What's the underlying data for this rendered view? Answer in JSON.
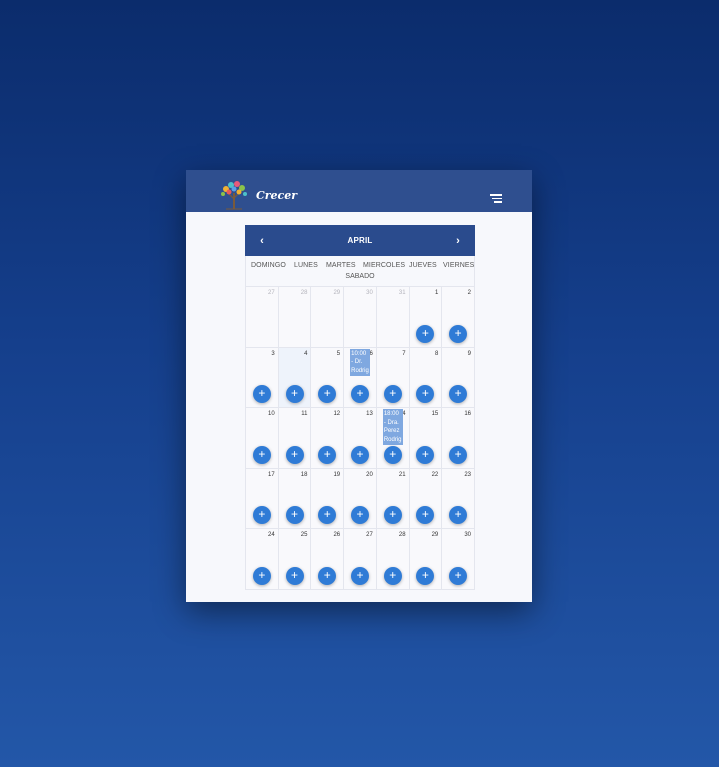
{
  "app": {
    "logo_text": "Crecer"
  },
  "calendar": {
    "month": "APRIL",
    "prev": "‹",
    "next": "›",
    "weekdays": [
      "DOMINGO",
      "LUNES",
      "MARTES",
      "MIERCOLES",
      "JUEVES",
      "VIERNES"
    ],
    "weekday_sat": "SABADO",
    "add_label": "+",
    "weeks": [
      [
        "27",
        "28",
        "29",
        "30",
        "31",
        "1",
        "2"
      ],
      [
        "3",
        "4",
        "5",
        "6",
        "7",
        "8",
        "9"
      ],
      [
        "10",
        "11",
        "12",
        "13",
        "14",
        "15",
        "16"
      ],
      [
        "17",
        "18",
        "19",
        "20",
        "21",
        "22",
        "23"
      ],
      [
        "24",
        "25",
        "26",
        "27",
        "28",
        "29",
        "30"
      ]
    ],
    "events": [
      {
        "lines": [
          "10:00",
          "- Dr.",
          "Rodrig"
        ]
      },
      {
        "lines": [
          "18:00",
          "- Dra.",
          "Perez",
          "Rodrig"
        ]
      }
    ]
  },
  "colors": {
    "header": "#2f4f8f",
    "calendar_header": "#2a4b8d",
    "add_button": "#2f7bd6",
    "event": "#7fa8e0"
  }
}
